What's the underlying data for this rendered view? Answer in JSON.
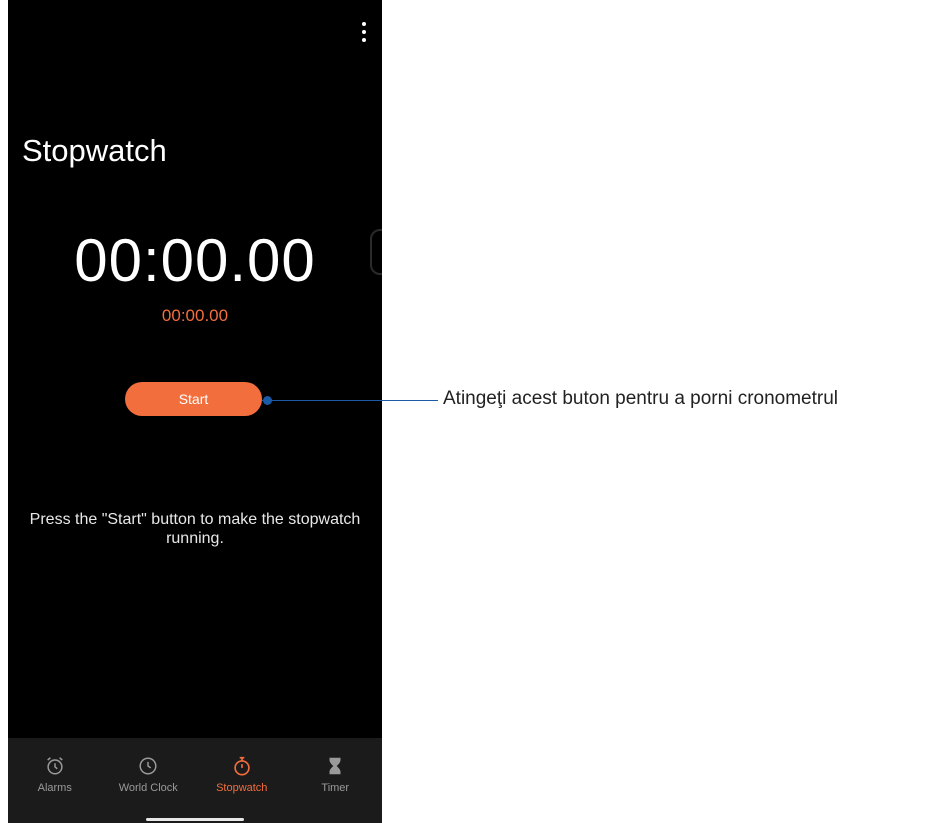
{
  "screen": {
    "title": "Stopwatch",
    "main_time": "00:00.00",
    "lap_time": "00:00.00",
    "start_label": "Start",
    "hint": "Press the \"Start\" button to make the stopwatch running."
  },
  "nav": {
    "items": [
      {
        "label": "Alarms",
        "icon": "alarm-clock-icon",
        "active": false
      },
      {
        "label": "World Clock",
        "icon": "clock-icon",
        "active": false
      },
      {
        "label": "Stopwatch",
        "icon": "stopwatch-icon",
        "active": true
      },
      {
        "label": "Timer",
        "icon": "hourglass-icon",
        "active": false
      }
    ]
  },
  "annotation": {
    "text": "Atingeţi acest buton pentru a porni cronometrul"
  },
  "colors": {
    "accent": "#f26e3d",
    "background": "#000000",
    "nav_background": "#1b1b1b",
    "callout": "#1a5aa6"
  }
}
